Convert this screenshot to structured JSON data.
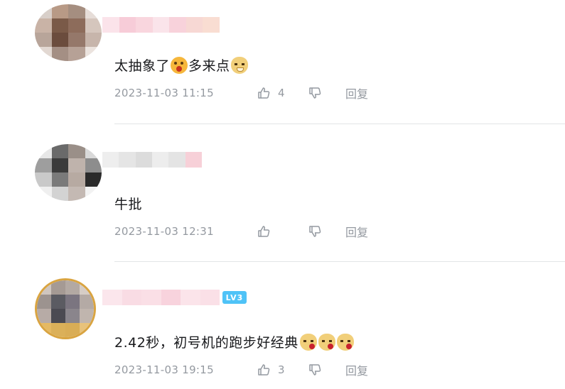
{
  "comments": [
    {
      "text_before": "太抽象了",
      "text_middle": "多来点",
      "emojis": [
        "shock-emoji",
        "doge-emoji"
      ],
      "time": "2023-11-03 11:15",
      "likes": "4",
      "reply_label": "回复"
    },
    {
      "text": "牛批",
      "time": "2023-11-03 12:31",
      "likes": "",
      "reply_label": "回复"
    },
    {
      "text": "2.42秒，初号机的跑步好经典",
      "emojis": [
        "rose-doge-emoji",
        "rose-doge-emoji",
        "rose-doge-emoji"
      ],
      "time": "2023-11-03 19:15",
      "likes": "3",
      "reply_label": "回复",
      "level_badge": "LV3"
    }
  ],
  "colors": {
    "meta_text": "#9499a0",
    "divider": "#e3e5e7",
    "level_badge": "#4fc3f7"
  }
}
